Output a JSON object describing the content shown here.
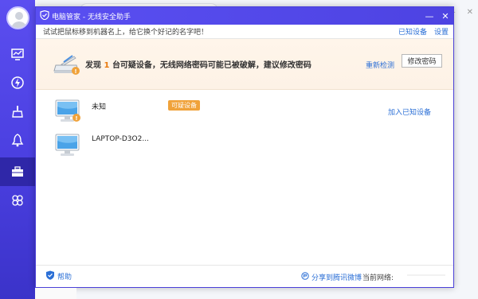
{
  "dialog": {
    "title": "电脑管家 - 无线安全助手",
    "tip": "试试把鼠标移到机器名上，给它换个好记的名字吧！",
    "links": {
      "known": "已知设备",
      "settings": "设置"
    },
    "alert": {
      "prefix": "发现",
      "count": "1",
      "suffix": "台可疑设备，无线网络密码可能已被破解，建议修改密码",
      "rescan": "重新检测",
      "change_password": "修改密码"
    },
    "devices": [
      {
        "name": "未知",
        "badge": "可疑设备",
        "action": "加入已知设备"
      },
      {
        "name": "LAPTOP-D3O2..."
      }
    ],
    "status": {
      "help": "帮助",
      "share": "分享到腾讯微博",
      "network_label": "当前网络:"
    }
  },
  "colors": {
    "titlebar": "#5a4ff2",
    "link": "#2b6fd6",
    "warning": "#e8790d",
    "badge": "#f0a23a"
  },
  "icons": [
    "shield-logo-icon",
    "minimize-icon",
    "close-icon",
    "scanner-icon",
    "computer-icon",
    "warning-icon",
    "help-shield-icon",
    "share-icon"
  ]
}
